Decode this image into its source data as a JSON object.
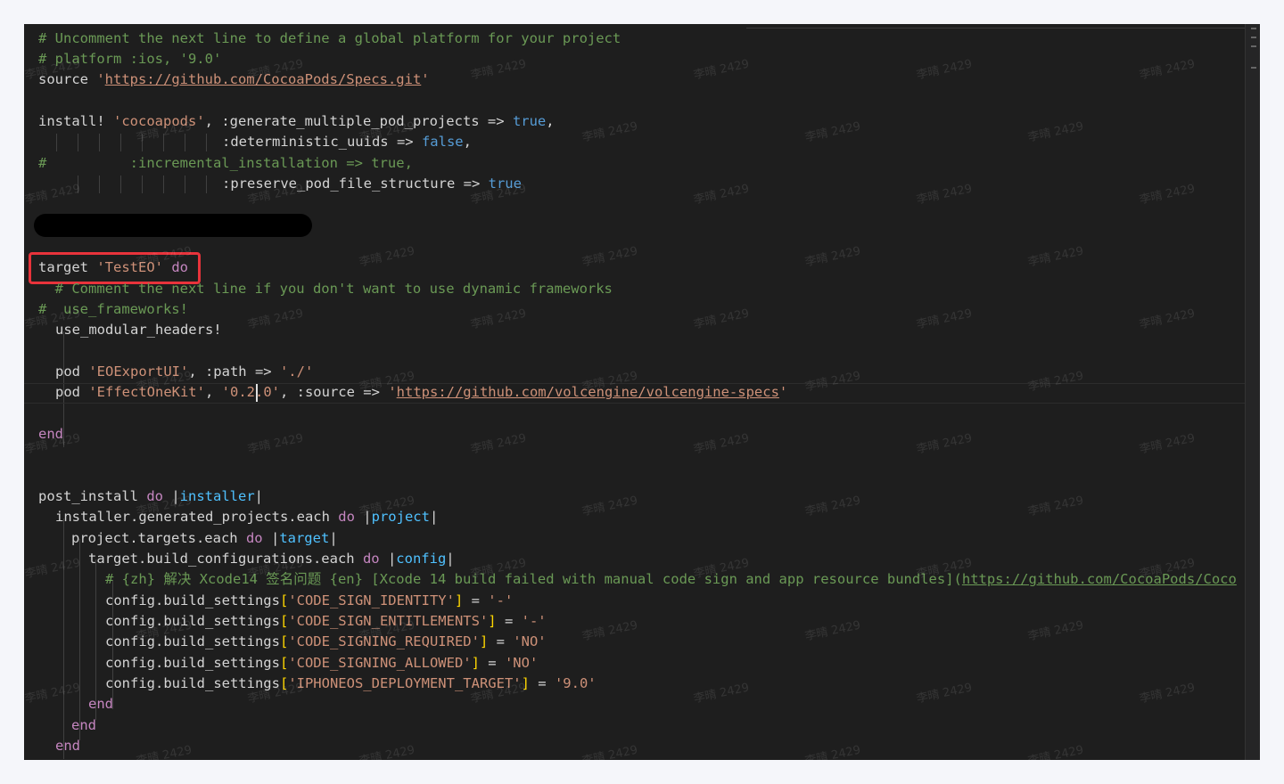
{
  "editor": {
    "lines": {
      "l1": "# Uncomment the next line to define a global platform for your project",
      "l2": "# platform :ios, '9.0'",
      "l3_kw": "source ",
      "l3_q1": "'",
      "l3_url": "https://github.com/CocoaPods/Specs.git",
      "l3_q2": "'",
      "l5_a": "install! ",
      "l5_str": "'cocoapods'",
      "l5_b": ", :generate_multiple_pod_projects => ",
      "l5_bool": "true",
      "l5_c": ",",
      "l6_a": ":deterministic_uuids => ",
      "l6_bool": "false",
      "l6_c": ",",
      "l7": "#          :incremental_installation => true,",
      "l8_a": ":preserve_pod_file_structure => ",
      "l8_bool": "true",
      "l11_a": "target ",
      "l11_str": "'TestEO'",
      "l11_kw": " do",
      "l12": "  # Comment the next line if you don't want to use dynamic frameworks",
      "l13": "#  use_frameworks!",
      "l14": "use_modular_headers!",
      "l16_a": "pod ",
      "l16_str": "'EOExportUI'",
      "l16_b": ", :path => ",
      "l16_str2": "'./'",
      "l17_a": "pod ",
      "l17_str": "'EffectOneKit'",
      "l17_b": ", ",
      "l17_str2": "'0.2.0'",
      "l17_c": ", :source => ",
      "l17_q1": "'",
      "l17_url": "https://github.com/volcengine/volcengine-specs",
      "l17_q2": "'",
      "l19": "end",
      "l22_a": "post_install ",
      "l22_kw": "do",
      "l22_b": " |",
      "l22_var": "installer",
      "l22_c": "|",
      "l23_a": "installer.generated_projects.each ",
      "l23_kw": "do",
      "l23_b": " |",
      "l23_var": "project",
      "l23_c": "|",
      "l24_a": "project.targets.each ",
      "l24_kw": "do",
      "l24_b": " |",
      "l24_var": "target",
      "l24_c": "|",
      "l25_a": "target.build_configurations.each ",
      "l25_kw": "do",
      "l25_b": " |",
      "l25_var": "config",
      "l25_c": "|",
      "l26_cmt": "# {zh} 解决 Xcode14 签名问题 {en} [Xcode 14 build failed with manual code sign and app resource bundles](",
      "l26_url": "https://github.com/CocoaPods/Coco",
      "l27_a": "config.build_settings",
      "l27_str": "'CODE_SIGN_IDENTITY'",
      "l27_v": "'-'",
      "l28_a": "config.build_settings",
      "l28_str": "'CODE_SIGN_ENTITLEMENTS'",
      "l28_v": "'-'",
      "l29_a": "config.build_settings",
      "l29_str": "'CODE_SIGNING_REQUIRED'",
      "l29_v": "'NO'",
      "l30_a": "config.build_settings",
      "l30_str": "'CODE_SIGNING_ALLOWED'",
      "l30_v": "'NO'",
      "l31_a": "config.build_settings",
      "l31_str": "'IPHONEOS_DEPLOYMENT_TARGET'",
      "l31_v": "'9.0'",
      "l32": "end",
      "l33": "end",
      "l34": "end"
    },
    "watermark_text": "李晴 2429",
    "colors": {
      "background": "#1e1e1e",
      "comment": "#6a9955",
      "string": "#ce9178",
      "keyword": "#c586c0",
      "boolean": "#569cd6",
      "highlight_box": "#e8333b"
    }
  }
}
